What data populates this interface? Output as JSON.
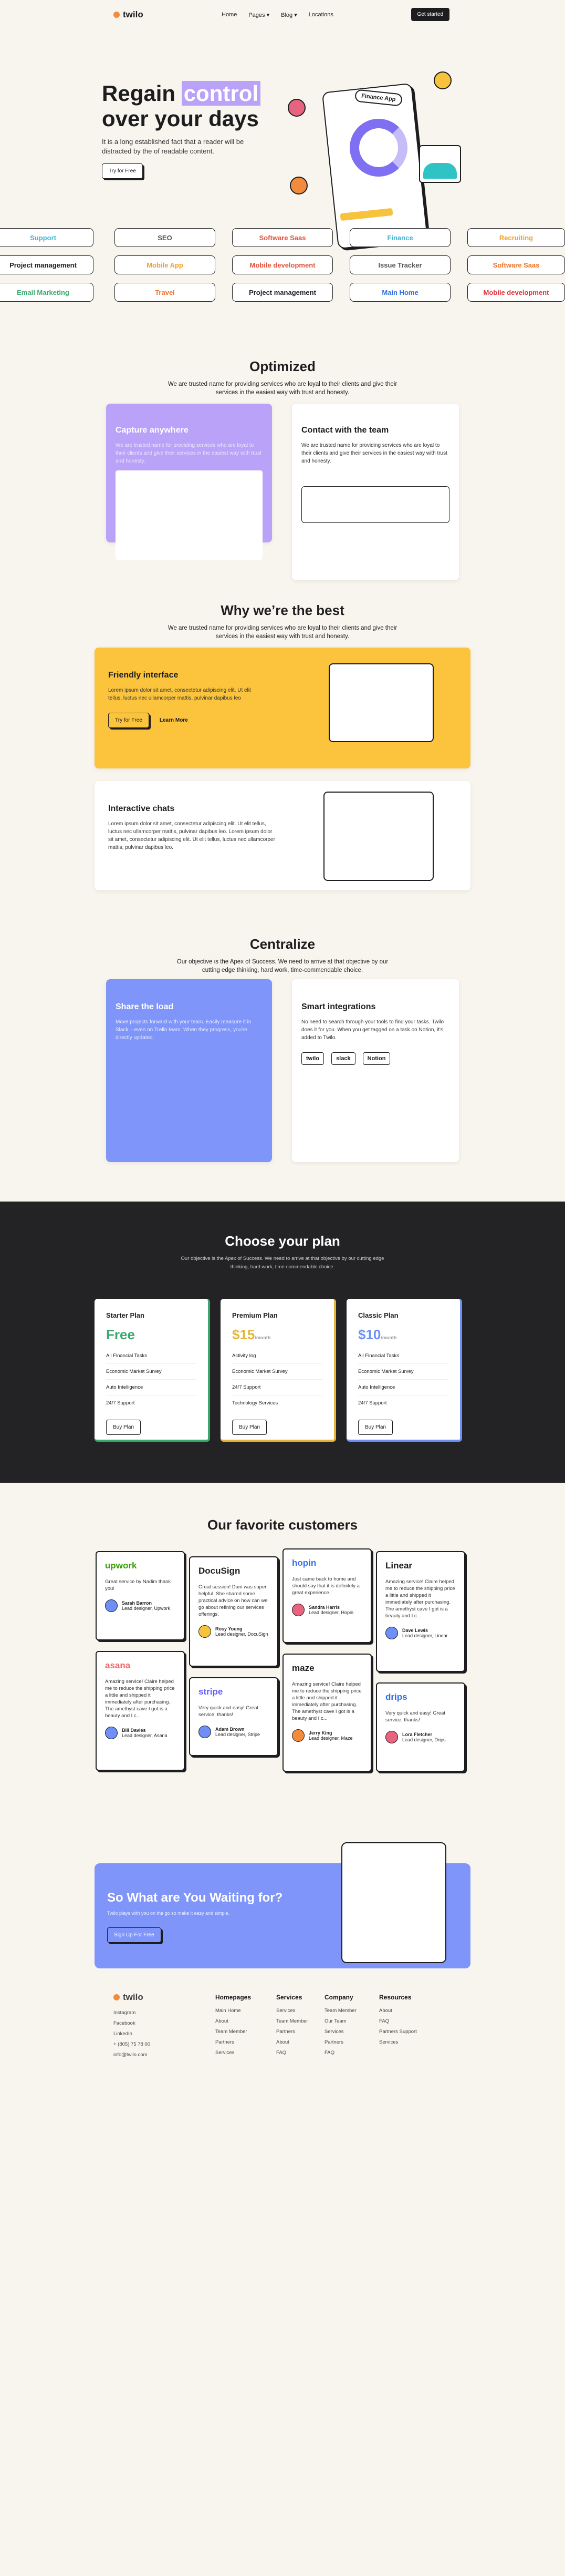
{
  "brand": "twilo",
  "nav": {
    "links": [
      "Home",
      "Pages",
      "Blog",
      "Locations"
    ],
    "cta": "Get started"
  },
  "hero": {
    "title_a": "Regain ",
    "title_hl": "control",
    "title_b": "over your days",
    "desc": "It is a long established fact that a reader will be distracted by the of readable content.",
    "button": "Try for Free",
    "pill": "Finance App"
  },
  "tags": [
    "Support",
    "SEO",
    "Software Saas",
    "Finance",
    "Recruiting",
    "Project management",
    "Mobile App",
    "Mobile development",
    "Issue Tracker",
    "Software Saas",
    "Email Marketing",
    "Travel",
    "Project management",
    "Main Home",
    "Mobile development"
  ],
  "optimized": {
    "title": "Optimized",
    "desc": "We are trusted name for providing services who are loyal to their clients and give their services in the easiest way with trust and honesty.",
    "card1": {
      "title": "Capture anywhere",
      "text": "We are trusted name for providing services who are loyal to their clients and give their services in the easiest way with trust and honesty."
    },
    "card2": {
      "title": "Contact with the team",
      "text": "We are trusted name for providing services who are loyal to their clients and give their services in the easiest way with trust and honesty."
    }
  },
  "why": {
    "title": "Why we’re the best",
    "desc": "We are trusted name for providing services who are loyal to their clients and give their services in the easiest way with trust and honesty.",
    "card1": {
      "title": "Friendly interface",
      "text": "Lorem ipsum dolor sit amet, consectetur adipiscing elit. Ut elit tellus, luctus nec ullamcorper mattis, pulvinar dapibus leo",
      "btn": "Try for Free",
      "link": "Learn More"
    },
    "card2": {
      "title": "Interactive chats",
      "text": "Lorem ipsum dolor sit amet, consectetur adipiscing elit. Ut elit tellus, luctus nec ullamcorper mattis, pulvinar dapibus leo. Lorem ipsum dolor sit amet, consectetur adipiscing elit. Ut elit tellus, luctus nec ullamcorper mattis, pulvinar dapibus leo."
    }
  },
  "centralize": {
    "title": "Centralize",
    "desc": "Our objective is the Apex of Success. We need to arrive at that objective by our cutting edge thinking, hard work, time-commendable choice.",
    "card1": {
      "title": "Share the load",
      "text": "Move projects forward with your team. Easily measure it in Slack – even on Trello team. When they progress, you're directly updated."
    },
    "card2": {
      "title": "Smart integrations",
      "text": "No need to search through your tools to find your tasks. Twilo does it for you. When you get tagged on a task on Notion, it's added to Twilo.",
      "badges": [
        "twilo",
        "slack",
        "Notion"
      ]
    }
  },
  "plans": {
    "title": "Choose your plan",
    "desc": "Our objective is the Apex of Success. We need to arrive at that objective by our cutting edge thinking, hard work, time-commendable choice.",
    "items": [
      {
        "name": "Starter Plan",
        "price": "Free",
        "per": "",
        "f": [
          "All Financial Tasks",
          "Economic Market Survey",
          "Auto Intelligence",
          "24/7 Support"
        ],
        "btn": "Buy Plan",
        "color": "#3aa76d"
      },
      {
        "name": "Premium Plan",
        "price": "$15",
        "per": "/month",
        "f": [
          "Activity log",
          "Economic Market Survey",
          "24/7 Support",
          "Technology Services"
        ],
        "btn": "Buy Plan",
        "color": "#e3b63a"
      },
      {
        "name": "Classic Plan",
        "price": "$10",
        "per": "/month",
        "f": [
          "All Financial Tasks",
          "Economic Market Survey",
          "Auto Intelligence",
          "24/7 Support"
        ],
        "btn": "Buy Plan",
        "color": "#6d8ff6"
      }
    ]
  },
  "customers": {
    "title": "Our favorite customers",
    "items": [
      {
        "brand": "upwork",
        "text": "Great service by Nadim thank you!",
        "name": "Sarah Barron",
        "role": "Lead designer, Upwork"
      },
      {
        "brand": "DocuSign",
        "text": "Great session! Dani was super helpful. She shared some practical advice on how can we go about refining our services offerings.",
        "name": "Rosy Young",
        "role": "Lead designer, DocuSign"
      },
      {
        "brand": "hopin",
        "text": "Just came back to home and should say that it is definitely a great experience.",
        "name": "Sandra Harris",
        "role": "Lead designer, Hopin"
      },
      {
        "brand": "Linear",
        "text": "Amazing service! Claire helped me to reduce the shipping price a little and shipped it immediately after purchasing. The amethyst cave I got is a beauty and I c...",
        "name": "Dave Lewis",
        "role": "Lead designer, Linear"
      },
      {
        "brand": "asana",
        "text": "Amazing service! Claire helped me to reduce the shipping price a little and shipped it immediately after purchasing. The amethyst cave I got is a beauty and I c...",
        "name": "Bill Davies",
        "role": "Lead designer, Asana"
      },
      {
        "brand": "stripe",
        "text": "Very quick and easy! Great service, thanks!",
        "name": "Adam Brown",
        "role": "Lead designer, Stripe"
      },
      {
        "brand": "maze",
        "text": "Amazing service! Claire helped me to reduce the shipping price a little and shipped it immediately after purchasing. The amethyst cave I got is a beauty and I c...",
        "name": "Jerry King",
        "role": "Lead designer, Maze"
      },
      {
        "brand": "drips",
        "text": "Very quick and easy! Great service, thanks!",
        "name": "Lora Fletcher",
        "role": "Lead designer, Drips"
      }
    ]
  },
  "cta": {
    "title": "So What are You Waiting for?",
    "desc": "Twilo plays with you on the go so make it easy and simple.",
    "btn": "Sign Up For Free"
  },
  "footer": {
    "contact": [
      "Instagram",
      "Facebook",
      "LinkedIn",
      "+ (805) 75 78 00",
      "info@twilo.com"
    ],
    "cols": [
      {
        "h": "Homepages",
        "items": [
          "Main Home",
          "About",
          "Team Member",
          "Partners",
          "Services"
        ]
      },
      {
        "h": "Services",
        "items": [
          "Services",
          "Team Member",
          "Partners",
          "About",
          "FAQ"
        ]
      },
      {
        "h": "Company",
        "items": [
          "Team Member",
          "Our Team",
          "Services",
          "Partners",
          "FAQ"
        ]
      },
      {
        "h": "Resources",
        "items": [
          "About",
          "FAQ",
          "Partners Support",
          "Services"
        ]
      }
    ]
  }
}
